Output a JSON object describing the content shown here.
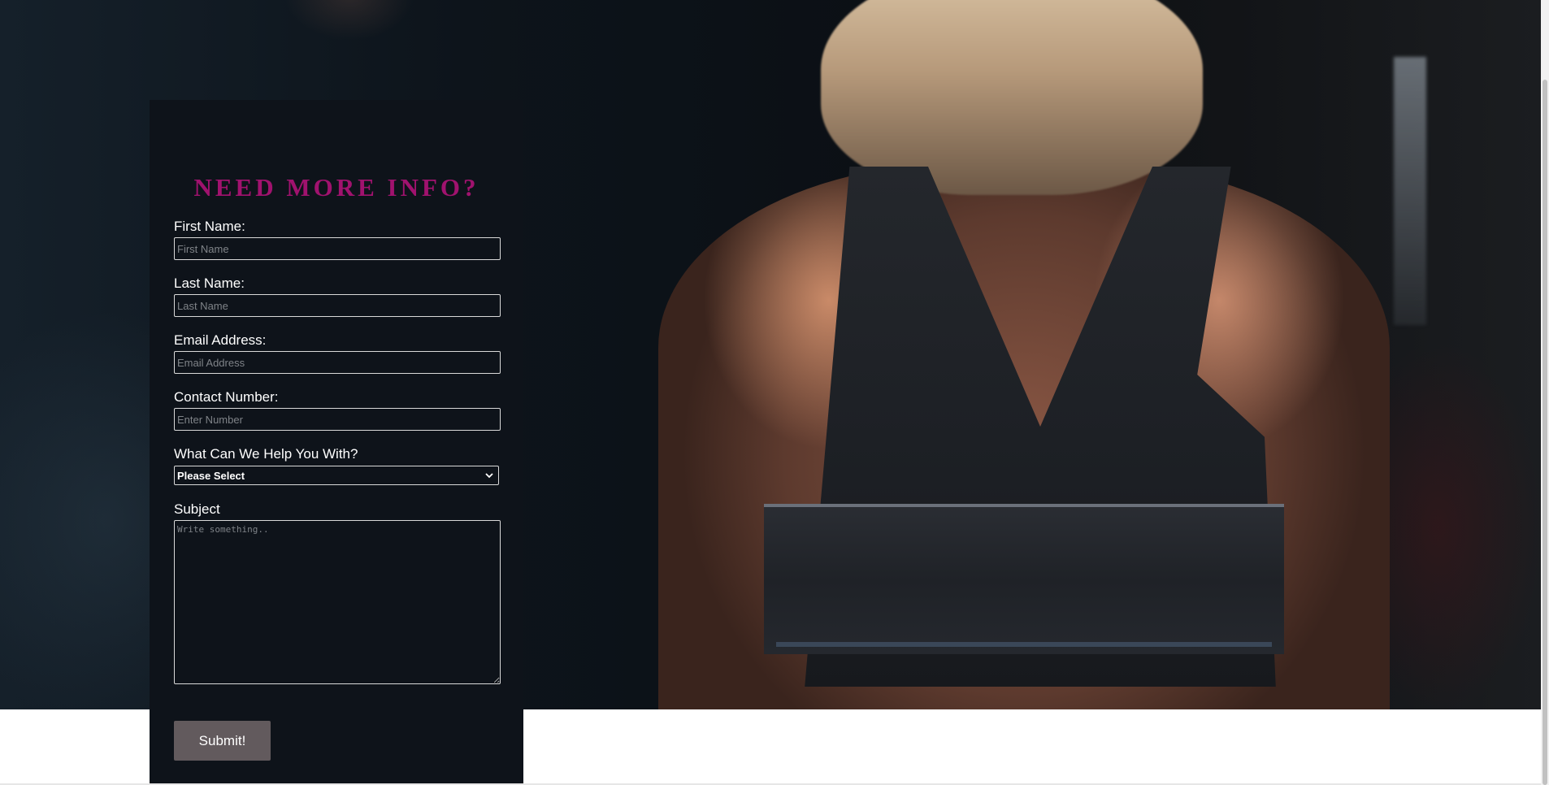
{
  "form": {
    "title": "NEED MORE INFO?",
    "first_name": {
      "label": "First Name:",
      "placeholder": "First Name",
      "value": ""
    },
    "last_name": {
      "label": "Last Name:",
      "placeholder": "Last Name",
      "value": ""
    },
    "email": {
      "label": "Email Address:",
      "placeholder": "Email Address",
      "value": ""
    },
    "contact": {
      "label": "Contact Number:",
      "placeholder": "Enter Number",
      "value": ""
    },
    "help": {
      "label": "What Can We Help You With?",
      "selected": "Please Select"
    },
    "subject": {
      "label": "Subject",
      "placeholder": "Write something..",
      "value": ""
    },
    "submit_label": "Submit!"
  },
  "colors": {
    "title_accent": "#a0126e",
    "panel_background": "#0e131a",
    "submit_button": "#625a5d"
  },
  "icons": {
    "select_caret": "chevron-down-icon"
  }
}
